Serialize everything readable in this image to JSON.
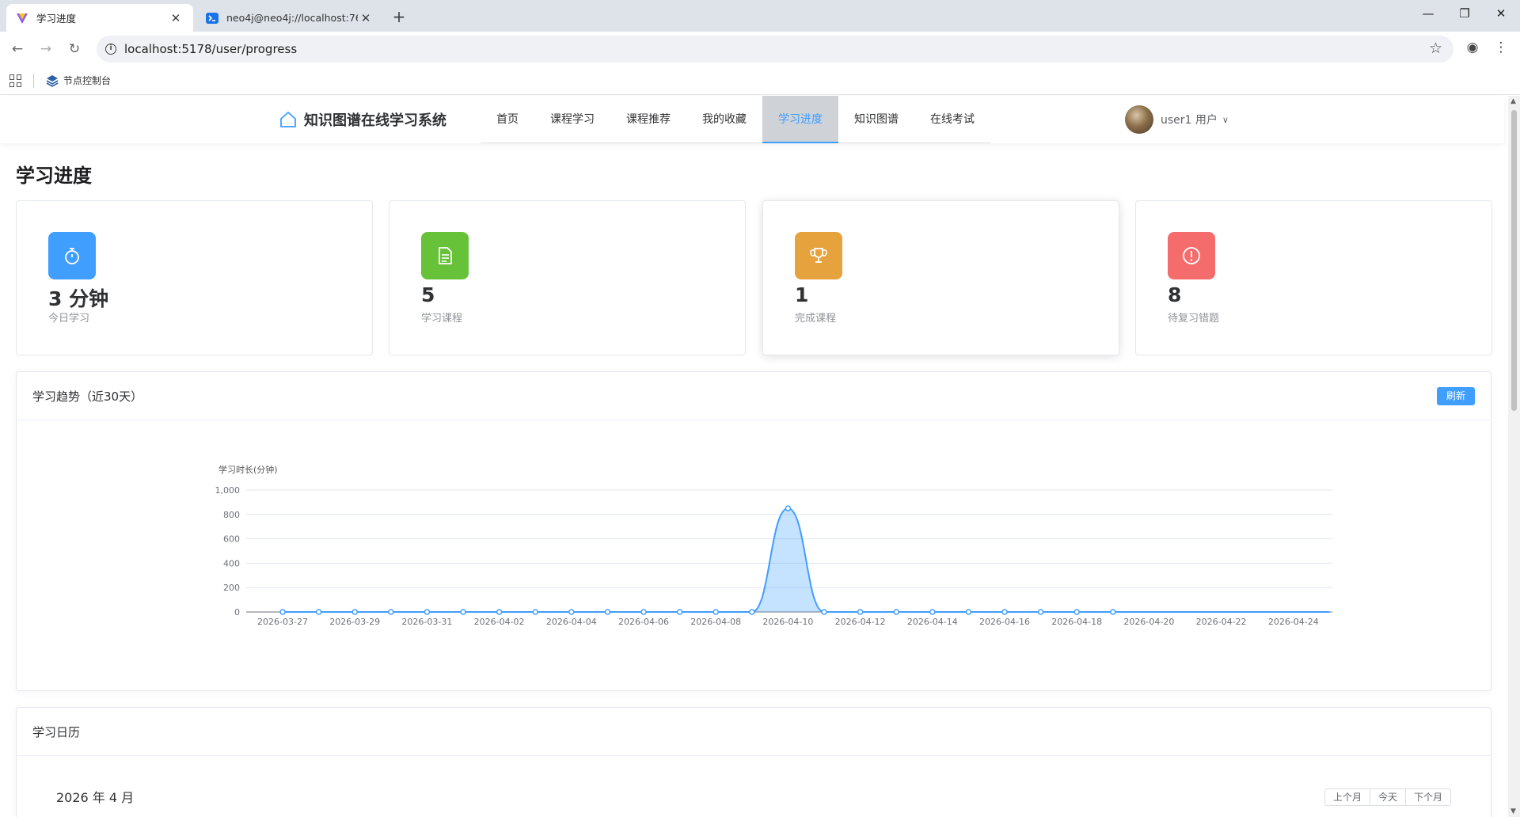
{
  "browser": {
    "tabs": [
      {
        "title": "学习进度",
        "active": true
      },
      {
        "title": "neo4j@neo4j://localhost:768",
        "active": false
      }
    ],
    "url": "localhost:5178/user/progress",
    "bookmarks": [
      {
        "label": "节点控制台"
      }
    ]
  },
  "header": {
    "logo": "知识图谱在线学习系统",
    "menu": [
      "首页",
      "课程学习",
      "课程推荐",
      "我的收藏",
      "学习进度",
      "知识图谱",
      "在线考试"
    ],
    "active_menu_index": 4,
    "user": "user1 用户"
  },
  "page": {
    "title": "学习进度"
  },
  "stats": [
    {
      "value": "3 分钟",
      "label": "今日学习",
      "icon": "stopwatch-icon",
      "color": "#409eff"
    },
    {
      "value": "5",
      "label": "学习课程",
      "icon": "document-icon",
      "color": "#67c23a"
    },
    {
      "value": "1",
      "label": "完成课程",
      "icon": "trophy-icon",
      "color": "#e6a23c"
    },
    {
      "value": "8",
      "label": "待复习错题",
      "icon": "warning-icon",
      "color": "#f56c6c"
    }
  ],
  "trend": {
    "title": "学习趋势（近30天）",
    "refresh_label": "刷新"
  },
  "chart_data": {
    "type": "area",
    "ylabel": "学习时长(分钟)",
    "ylim": [
      0,
      1000
    ],
    "yticks": [
      0,
      200,
      400,
      600,
      800,
      1000
    ],
    "ytick_labels": [
      "0",
      "200",
      "400",
      "600",
      "800",
      "1,000"
    ],
    "xtick_labels": [
      "2026-03-27",
      "2026-03-29",
      "2026-03-31",
      "2026-04-02",
      "2026-04-04",
      "2026-04-06",
      "2026-04-08",
      "2026-04-10",
      "2026-04-12",
      "2026-04-14",
      "2026-04-16",
      "2026-04-18",
      "2026-04-20",
      "2026-04-22",
      "2026-04-24"
    ],
    "x": [
      "2026-03-27",
      "2026-03-28",
      "2026-03-29",
      "2026-03-30",
      "2026-03-31",
      "2026-04-01",
      "2026-04-02",
      "2026-04-03",
      "2026-04-04",
      "2026-04-05",
      "2026-04-06",
      "2026-04-07",
      "2026-04-08",
      "2026-04-09",
      "2026-04-10",
      "2026-04-11",
      "2026-04-12",
      "2026-04-13",
      "2026-04-14",
      "2026-04-15",
      "2026-04-16",
      "2026-04-17",
      "2026-04-18",
      "2026-04-19",
      "2026-04-20",
      "2026-04-21",
      "2026-04-22",
      "2026-04-23",
      "2026-04-24",
      "2026-04-25"
    ],
    "series": [
      {
        "values": [
          0,
          0,
          0,
          0,
          0,
          0,
          0,
          0,
          0,
          0,
          0,
          0,
          0,
          0,
          850,
          0,
          0,
          0,
          0,
          0,
          0,
          0,
          0,
          0,
          0,
          0,
          0,
          0,
          0,
          0
        ],
        "color": "#409eff"
      }
    ],
    "points_shown": 24,
    "grid": true
  },
  "calendar": {
    "title": "学习日历",
    "month_label": "2026 年 4 月",
    "buttons": [
      "上个月",
      "今天",
      "下个月"
    ]
  }
}
